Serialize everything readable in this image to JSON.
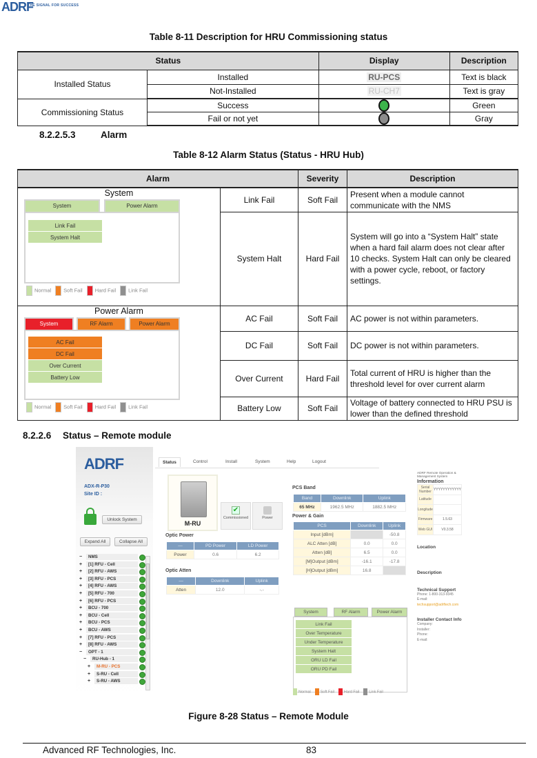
{
  "header": {
    "logo_text": "ADRF",
    "tagline": "THE SIGNAL FOR SUCCESS"
  },
  "table_8_11": {
    "caption": "Table 8-11     Description for HRU Commissioning status",
    "headers": [
      "Status",
      "Display",
      "Description"
    ],
    "groups": [
      {
        "label": "Installed Status",
        "rows": [
          {
            "state": "Installed",
            "display": "RU-PCS",
            "description": "Text is black"
          },
          {
            "state": "Not-Installed",
            "display": "RU-CH7",
            "description": "Text is gray"
          }
        ]
      },
      {
        "label": "Commissioning  Status",
        "rows": [
          {
            "state": "Success",
            "display_color": "#3cb44b",
            "description": "Green"
          },
          {
            "state": "Fail or not yet",
            "display_color": "#8c8c8c",
            "description": "Gray"
          }
        ]
      }
    ]
  },
  "section_alarm": {
    "number": "8.2.2.5.3",
    "title": "Alarm"
  },
  "table_8_12": {
    "caption": "Table 8-12     Alarm Status (Status - HRU Hub)",
    "headers": [
      "Alarm",
      "Severity",
      "Description"
    ],
    "system_group": {
      "title": "System",
      "tabs": [
        "System",
        "Power Alarm"
      ],
      "items": [
        "Link Fail",
        "System Halt"
      ],
      "rows": [
        {
          "alarm": "Link Fail",
          "severity": "Soft Fail",
          "description": "Present when a module cannot communicate with the NMS"
        },
        {
          "alarm": "System Halt",
          "severity": "Hard Fail",
          "description": "System will go into a “System Halt” state when a hard fail alarm does not clear after 10 checks.  System Halt can only be cleared with a power cycle, reboot, or factory settings."
        }
      ]
    },
    "power_group": {
      "title": "Power Alarm",
      "tabs": [
        "System",
        "RF Alarm",
        "Power Alarm"
      ],
      "items": [
        "AC Fail",
        "DC Fail",
        "Over Current",
        "Battery Low"
      ],
      "rows": [
        {
          "alarm": "AC Fail",
          "severity": "Soft Fail",
          "description": "AC power is not within parameters."
        },
        {
          "alarm": "DC Fail",
          "severity": "Soft Fail",
          "description": "DC power is not within parameters."
        },
        {
          "alarm": "Over Current",
          "severity": "Hard Fail",
          "description": "Total current of HRU is higher than the threshold level for over current alarm"
        },
        {
          "alarm": "Battery Low",
          "severity": "Soft Fail",
          "description": "Voltage of battery connected to HRU PSU is lower than the defined threshold"
        }
      ]
    },
    "legend": [
      "Normal",
      "Soft Fail",
      "Hard Fail",
      "Link Fail"
    ]
  },
  "section_remote": {
    "number": "8.2.2.6",
    "title": "Status – Remote module"
  },
  "screenshot": {
    "logo": "ADRF",
    "model": "ADX-R-P30",
    "site_id": "Site ID :",
    "unlock_button": "Unlock System",
    "expand_all": "Expand All",
    "collapse_all": "Collapse All",
    "nav_tabs": [
      "Status",
      "Control",
      "Install",
      "System",
      "Help",
      "Logout"
    ],
    "tree": [
      {
        "sign": "−",
        "label": "NMS",
        "indent": 0
      },
      {
        "sign": "+",
        "label": "[1] RFU - Cell",
        "indent": 1
      },
      {
        "sign": "+",
        "label": "[2] RFU - AWS",
        "indent": 1
      },
      {
        "sign": "+",
        "label": "[3] RFU - PCS",
        "indent": 1
      },
      {
        "sign": "+",
        "label": "[4] RFU - AWS",
        "indent": 1
      },
      {
        "sign": "+",
        "label": "[5] RFU - 700",
        "indent": 1
      },
      {
        "sign": "+",
        "label": "[6] RFU - PCS",
        "indent": 1
      },
      {
        "sign": "+",
        "label": "BCU - 700",
        "indent": 1
      },
      {
        "sign": "+",
        "label": "BCU - Cell",
        "indent": 1
      },
      {
        "sign": "+",
        "label": "BCU - PCS",
        "indent": 1
      },
      {
        "sign": "+",
        "label": "BCU - AWS",
        "indent": 1
      },
      {
        "sign": "+",
        "label": "[7] RFU - PCS",
        "indent": 1
      },
      {
        "sign": "+",
        "label": "[8] RFU - AWS",
        "indent": 1
      },
      {
        "sign": "−",
        "label": "OPT - 1",
        "indent": 1
      },
      {
        "sign": "−",
        "label": "RU-Hub - 1",
        "indent": 2
      },
      {
        "sign": "+",
        "label": "M-RU - PCS",
        "indent": 3,
        "selected": true
      },
      {
        "sign": "+",
        "label": "S-RU - Cell",
        "indent": 3
      },
      {
        "sign": "+",
        "label": "S-RU - AWS",
        "indent": 3
      }
    ],
    "device_name": "M-RU",
    "commissioned_label": "Commissioned",
    "power_label": "Power",
    "optic_power": {
      "title": "Optic Power",
      "headers": [
        "—",
        "PD Power",
        "LD Power"
      ],
      "rows": [
        [
          "Power",
          "0.6",
          "6.2"
        ]
      ]
    },
    "optic_atten": {
      "title": "Optic Atten",
      "headers": [
        "—",
        "Downlink",
        "Uplink"
      ],
      "rows": [
        [
          "Atten",
          "12.0",
          "-.-"
        ]
      ]
    },
    "pcs_band": {
      "title": "PCS Band",
      "headers": [
        "Band",
        "Downlink",
        "Uplink"
      ],
      "rows": [
        [
          "65 MHz",
          "1962.5 MHz",
          "1882.5 MHz"
        ]
      ]
    },
    "power_gain": {
      "title": "Power & Gain",
      "headers": [
        "PCS",
        "Downlink",
        "Uplink"
      ],
      "rows": [
        [
          "Input [dBm]",
          "",
          "-50.8"
        ],
        [
          "ALC Atten [dB]",
          "0.0",
          "0.0"
        ],
        [
          "Atten [dB]",
          "6.5",
          "0.0"
        ],
        [
          "[M]Output [dBm]",
          "-16.1",
          "-17.8"
        ],
        [
          "[H]Output [dBm]",
          "16.8",
          ""
        ]
      ]
    },
    "alarm_panel": {
      "tabs": [
        "System",
        "RF Alarm",
        "Power Alarm"
      ],
      "items": [
        "Link Fail",
        "Over Temperature",
        "Under Temperature",
        "System Halt",
        "ORU LD Fail",
        "ORU PD Fail"
      ],
      "legend": [
        "Normal",
        "Soft Fail",
        "Hard Fail",
        "Link Fail"
      ]
    },
    "info": {
      "system_title": "ADRF Remote Operation & Management System",
      "title": "Information",
      "rows": [
        [
          "Serial Number",
          "YYYYYYYYYYYY"
        ],
        [
          "Latitude",
          ""
        ],
        [
          "Longitude",
          ""
        ],
        [
          "Firmware",
          "1.5.63"
        ],
        [
          "Web GUI",
          "V0.3.58"
        ]
      ],
      "location": "Location",
      "description": "Description",
      "tech_support": "Technical Support",
      "phone": "Phone: 1-800-313-9345",
      "email_label": "E-mail: ",
      "email": "techsupport@adrftech.com",
      "installer_title": "Installer Contact Info",
      "installer_fields": [
        "Company:",
        "Installer:",
        "Phone:",
        "E-mail:"
      ]
    }
  },
  "figure_caption": "Figure 8-28   Status – Remote Module",
  "footer": {
    "company": "Advanced RF Technologies, Inc.",
    "page": "83"
  }
}
